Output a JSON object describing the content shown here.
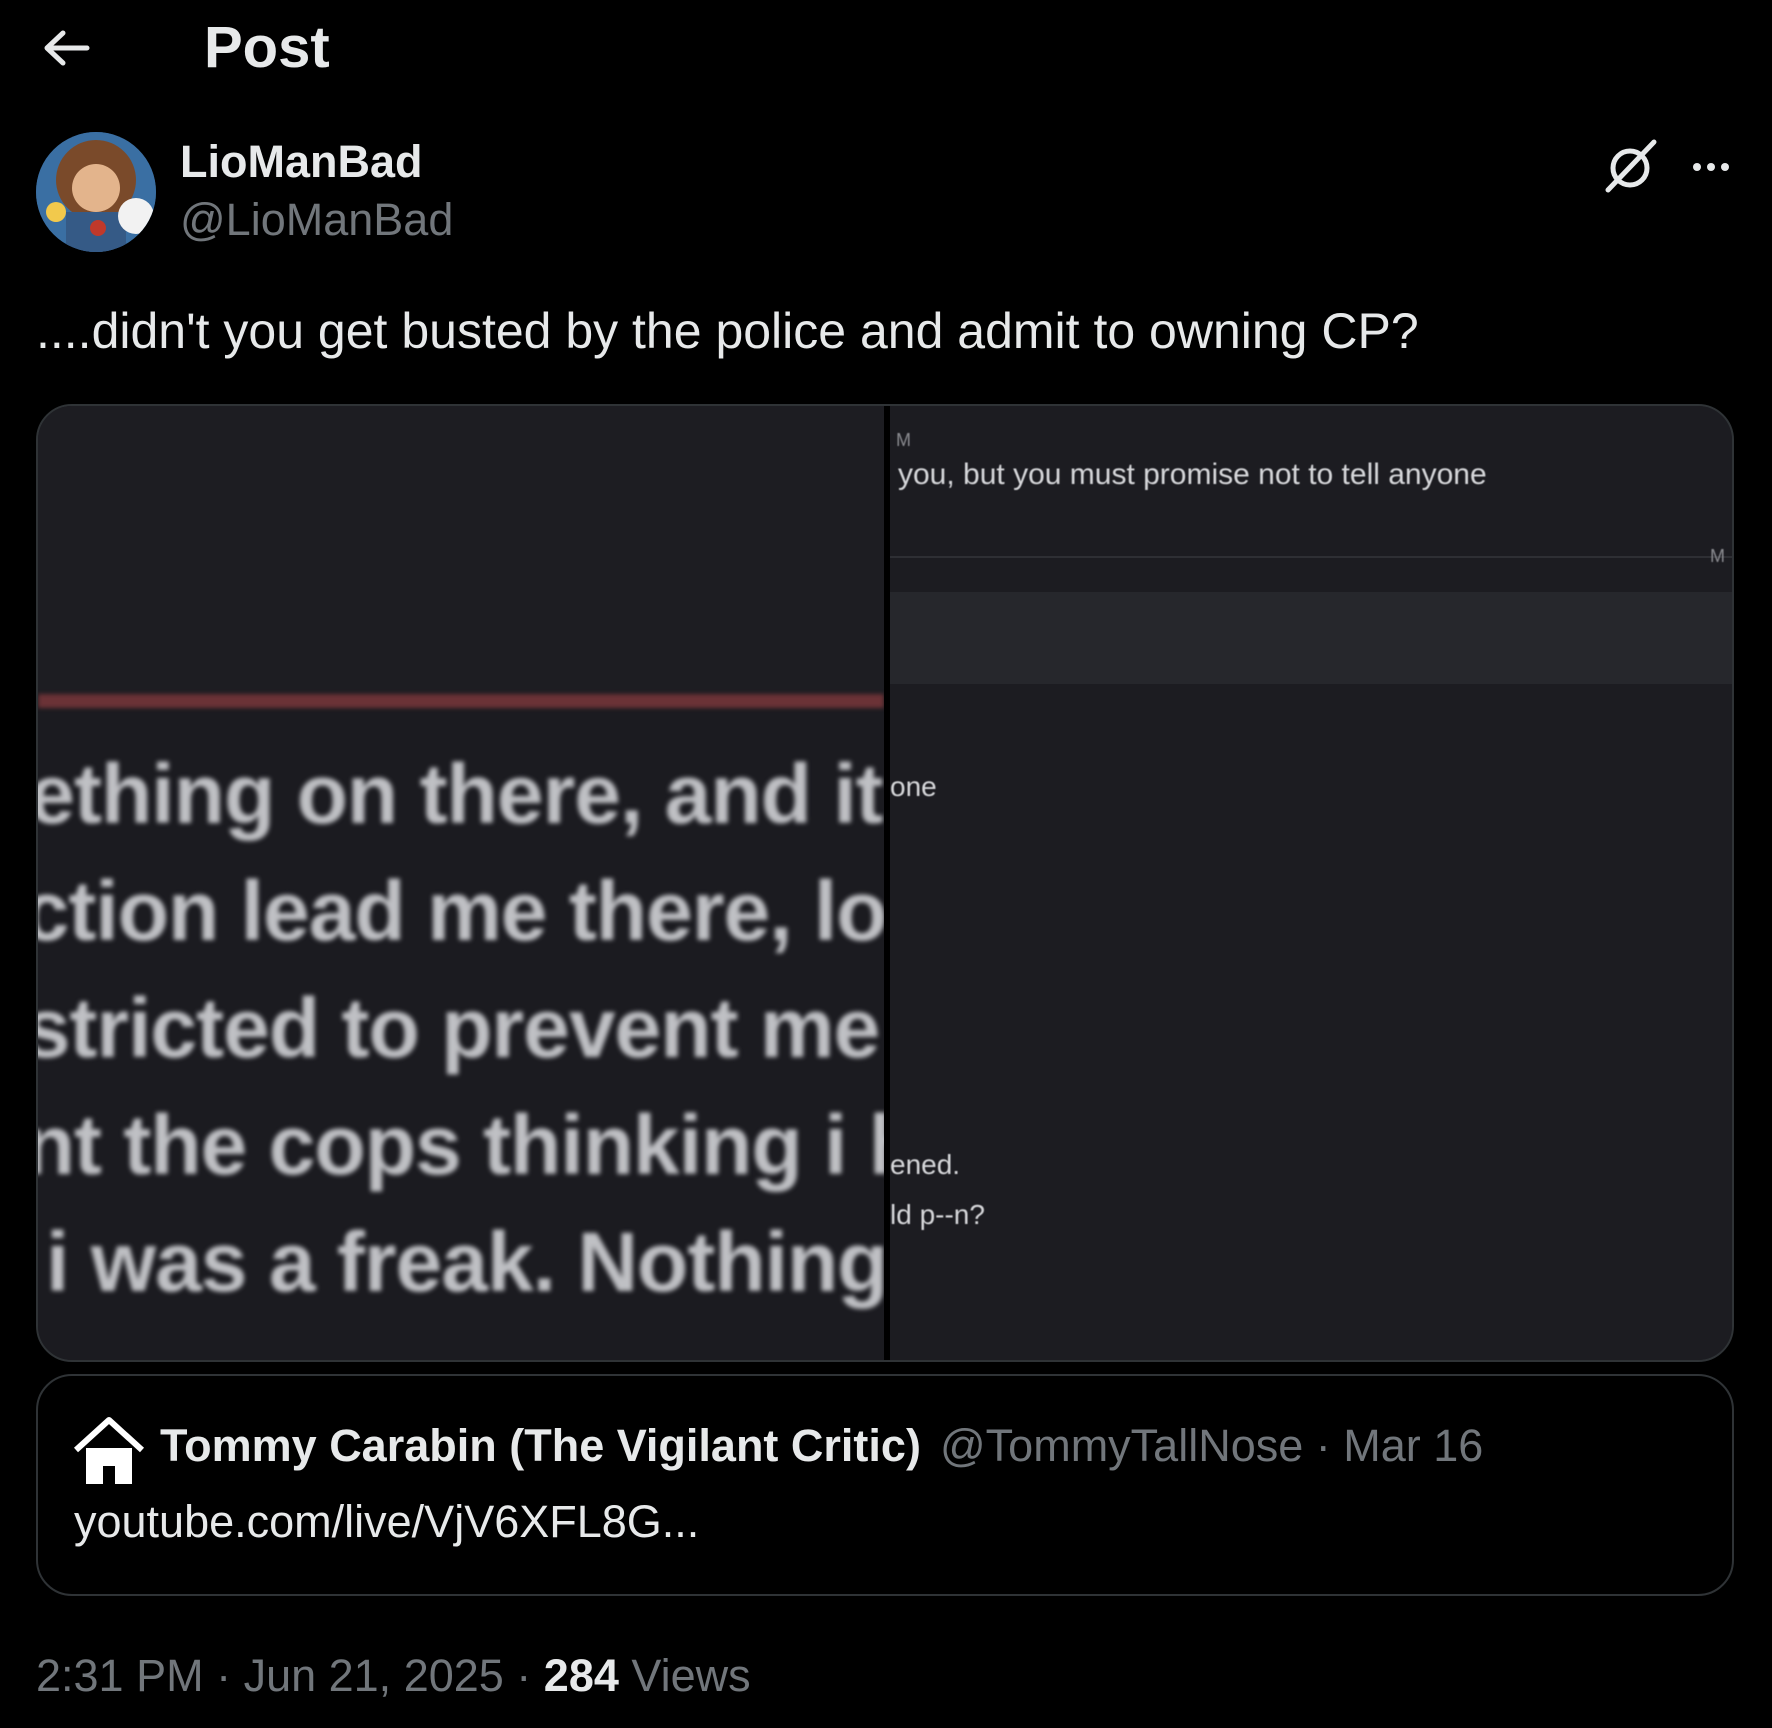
{
  "header": {
    "title": "Post",
    "back_icon": "arrow-left-icon"
  },
  "author": {
    "display_name": "LioManBad",
    "handle": "@LioManBad"
  },
  "post": {
    "text": "....didn't you get busted by the police and admit to owning CP?"
  },
  "media": {
    "left_lines": [
      "nething on there, and it c",
      "liction lead me there, lo",
      "estricted to prevent me t",
      "ant the cops thinking i h",
      "k i was a freak. Nothing i"
    ],
    "right_fragments": {
      "top_marker": "M",
      "line1": "you, but you must promise not to tell anyone",
      "right_marker": "M",
      "frag_one": "one",
      "frag_ened": "ened.",
      "frag_ldpn": "ld p--n?"
    }
  },
  "quote": {
    "name": "Tommy Carabin (The Vigilant Critic)",
    "handle_date": "@TommyTallNose · Mar 16",
    "text": "youtube.com/live/VjV6XFL8G..."
  },
  "meta": {
    "time_date": "2:31 PM · Jun 21, 2025 · ",
    "views_count": "284",
    "views_label": " Views"
  },
  "colors": {
    "background": "#000000",
    "text": "#e7e9ea",
    "secondary": "#71767b",
    "border": "#2f3336"
  }
}
